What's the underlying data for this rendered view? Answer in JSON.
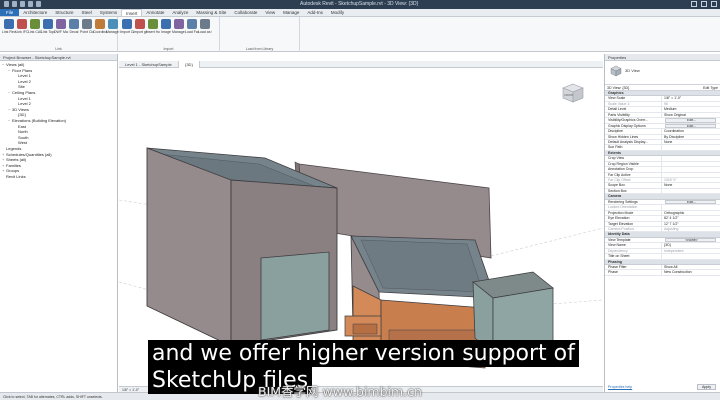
{
  "app": {
    "title_text": "Autodesk Revit - SketchupSample.rvt - 3D View: {3D}"
  },
  "ribbon": {
    "tabs": [
      {
        "label": "File"
      },
      {
        "label": "Architecture"
      },
      {
        "label": "Structure"
      },
      {
        "label": "Steel"
      },
      {
        "label": "Systems"
      },
      {
        "label": "Insert"
      },
      {
        "label": "Annotate"
      },
      {
        "label": "Analyze"
      },
      {
        "label": "Massing & Site"
      },
      {
        "label": "Collaborate"
      },
      {
        "label": "View"
      },
      {
        "label": "Manage"
      },
      {
        "label": "Add-Ins"
      },
      {
        "label": "Modify"
      }
    ],
    "groups": [
      {
        "title": "Link",
        "buttons": [
          "Link Revit",
          "Link IFC",
          "Link CAD",
          "Link Topography",
          "DWF Markup",
          "Decal",
          "Point Cloud",
          "Coordination Model",
          "Manage Links"
        ]
      },
      {
        "title": "Import",
        "buttons": [
          "Import CAD",
          "Import gbXML",
          "Insert from File",
          "Image",
          "Manage Images",
          "Load Family",
          "Load as Group"
        ]
      },
      {
        "title": "Load from Library",
        "buttons": []
      }
    ]
  },
  "project_browser": {
    "title": "Project Browser - SketchupSample.rvt",
    "items": [
      {
        "label": "Views (all)",
        "level": 0,
        "toggle": "−"
      },
      {
        "label": "Floor Plans",
        "level": 1,
        "toggle": "−"
      },
      {
        "label": "Level 1",
        "level": 2,
        "toggle": ""
      },
      {
        "label": "Level 2",
        "level": 2,
        "toggle": ""
      },
      {
        "label": "Site",
        "level": 2,
        "toggle": ""
      },
      {
        "label": "Ceiling Plans",
        "level": 1,
        "toggle": "−"
      },
      {
        "label": "Level 1",
        "level": 2,
        "toggle": ""
      },
      {
        "label": "Level 2",
        "level": 2,
        "toggle": ""
      },
      {
        "label": "3D Views",
        "level": 1,
        "toggle": "−"
      },
      {
        "label": "{3D}",
        "level": 2,
        "toggle": ""
      },
      {
        "label": "Elevations (Building Elevation)",
        "level": 1,
        "toggle": "−"
      },
      {
        "label": "East",
        "level": 2,
        "toggle": ""
      },
      {
        "label": "North",
        "level": 2,
        "toggle": ""
      },
      {
        "label": "South",
        "level": 2,
        "toggle": ""
      },
      {
        "label": "West",
        "level": 2,
        "toggle": ""
      },
      {
        "label": "Legends",
        "level": 0,
        "toggle": ""
      },
      {
        "label": "Schedules/Quantities (all)",
        "level": 0,
        "toggle": "+"
      },
      {
        "label": "Sheets (all)",
        "level": 0,
        "toggle": "+"
      },
      {
        "label": "Families",
        "level": 0,
        "toggle": "+"
      },
      {
        "label": "Groups",
        "level": 0,
        "toggle": "+"
      },
      {
        "label": "Revit Links",
        "level": 0,
        "toggle": ""
      }
    ]
  },
  "view_tabs": [
    {
      "label": "Level 1 - SketchupSample",
      "active": false
    },
    {
      "label": "{3D}",
      "active": true
    }
  ],
  "view_control_bar": {
    "scale": "1/8\" = 1'-0\""
  },
  "status_bar": {
    "text": "Click to select, TAB for alternates, CTRL adds, SHIFT unselects."
  },
  "properties": {
    "title": "Properties",
    "type_name": "3D View",
    "type_row": {
      "label": "3D View: {3D}",
      "edit": "Edit Type"
    },
    "sections": [
      {
        "name": "Graphics",
        "rows": [
          {
            "key": "View Scale",
            "value": "1/8\" = 1'-0\""
          },
          {
            "key": "Scale Value 1:",
            "value": "96",
            "dim": true
          },
          {
            "key": "Detail Level",
            "value": "Medium"
          },
          {
            "key": "Parts Visibility",
            "value": "Show Original"
          },
          {
            "key": "Visibility/Graphics Overr...",
            "value": "Edit...",
            "button": true
          },
          {
            "key": "Graphic Display Options",
            "value": "Edit...",
            "button": true
          },
          {
            "key": "Discipline",
            "value": "Coordination"
          },
          {
            "key": "Show Hidden Lines",
            "value": "By Discipline"
          },
          {
            "key": "Default Analysis Display...",
            "value": "None"
          },
          {
            "key": "Sun Path",
            "value": ""
          }
        ]
      },
      {
        "name": "Extents",
        "rows": [
          {
            "key": "Crop View",
            "value": ""
          },
          {
            "key": "Crop Region Visible",
            "value": ""
          },
          {
            "key": "Annotation Crop",
            "value": ""
          },
          {
            "key": "Far Clip Active",
            "value": ""
          },
          {
            "key": "Far Clip Offset",
            "value": "1000' 0\"",
            "dim": true
          },
          {
            "key": "Scope Box",
            "value": "None"
          },
          {
            "key": "Section Box",
            "value": ""
          }
        ]
      },
      {
        "name": "Camera",
        "rows": [
          {
            "key": "Rendering Settings",
            "value": "Edit...",
            "button": true
          },
          {
            "key": "Locked Orientation",
            "value": "",
            "dim": true
          },
          {
            "key": "Projection Mode",
            "value": "Orthographic"
          },
          {
            "key": "Eye Elevation",
            "value": "82' 4 1/2\""
          },
          {
            "key": "Target Elevation",
            "value": "12' 7 1/2\""
          },
          {
            "key": "Camera Position",
            "value": "Adjusting",
            "dim": true
          }
        ]
      },
      {
        "name": "Identity Data",
        "rows": [
          {
            "key": "View Template",
            "value": "<None>",
            "button": true
          },
          {
            "key": "View Name",
            "value": "{3D}"
          },
          {
            "key": "Dependency",
            "value": "Independent",
            "dim": true
          },
          {
            "key": "Title on Sheet",
            "value": ""
          }
        ]
      },
      {
        "name": "Phasing",
        "rows": [
          {
            "key": "Phase Filter",
            "value": "Show All"
          },
          {
            "key": "Phase",
            "value": "New Construction"
          }
        ]
      }
    ],
    "help_link": "Properties help",
    "apply": "Apply"
  },
  "viewcube": {
    "face_label": "FRONT"
  },
  "caption": {
    "line1": "and we offer higher version support of",
    "line2": "SketchUp files"
  },
  "watermark": "BIM香学网 www.bimbim.cn",
  "colors": {
    "wall_gray": "#958a8c",
    "roof_dark": "#77838b",
    "orange": "#d38958",
    "door_green": "#8aa09e",
    "accent_blue": "#2a6fb8"
  }
}
